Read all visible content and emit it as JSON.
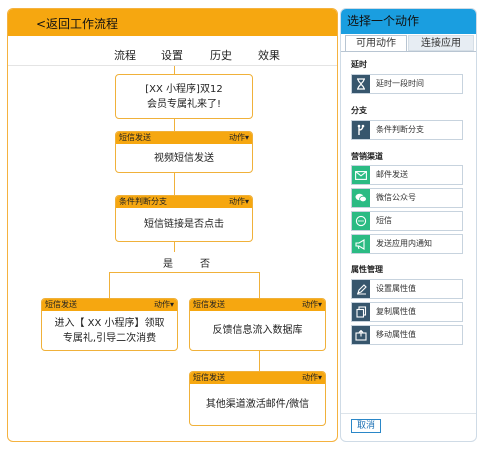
{
  "header": {
    "back_label": "<返回工作流程"
  },
  "tabs": [
    {
      "label": "流程",
      "active": true
    },
    {
      "label": "设置",
      "active": false
    },
    {
      "label": "历史",
      "active": false
    },
    {
      "label": "效果",
      "active": false
    }
  ],
  "flow": {
    "trigger_text": "[XX 小程序]双12\n会员专属礼来了!",
    "node_video": {
      "type": "短信发送",
      "action": "动作▾",
      "text": "视频短信发送"
    },
    "node_condition": {
      "type": "条件判断分支",
      "action": "动作▾",
      "text": "短信链接是否点击"
    },
    "branch_yes": "是",
    "branch_no": "否",
    "node_yes": {
      "type": "短信发送",
      "action": "动作▾",
      "text": "进入【 XX 小程序】领取\n专属礼,引导二次消费"
    },
    "node_no": {
      "type": "短信发送",
      "action": "动作▾",
      "text": "反馈信息流入数据库"
    },
    "node_no2": {
      "type": "短信发送",
      "action": "动作▾",
      "text": "其他渠道激活邮件/微信"
    }
  },
  "panel": {
    "title": "选择一个动作",
    "tab_available": "可用动作",
    "tab_connected": "连接应用",
    "sections": {
      "delay": {
        "title": "延时",
        "items": [
          {
            "label": "延时一段时间",
            "icon": "hourglass-icon"
          }
        ]
      },
      "branch": {
        "title": "分支",
        "items": [
          {
            "label": "条件判断分支",
            "icon": "branch-icon"
          }
        ]
      },
      "marketing": {
        "title": "营销渠道",
        "items": [
          {
            "label": "邮件发送",
            "icon": "mail-icon"
          },
          {
            "label": "微信公众号",
            "icon": "wechat-icon"
          },
          {
            "label": "短信",
            "icon": "sms-icon"
          },
          {
            "label": "发送应用内通知",
            "icon": "megaphone-icon"
          }
        ]
      },
      "attributes": {
        "title": "属性管理",
        "items": [
          {
            "label": "设置属性值",
            "icon": "pencil-icon"
          },
          {
            "label": "复制属性值",
            "icon": "copy-icon"
          },
          {
            "label": "移动属性值",
            "icon": "move-icon"
          }
        ]
      }
    },
    "cancel_label": "取消"
  },
  "colors": {
    "accent_orange": "#f6a710",
    "panel_blue": "#1a9ee0",
    "icon_dark": "#37566d",
    "icon_green": "#2bbb83"
  }
}
